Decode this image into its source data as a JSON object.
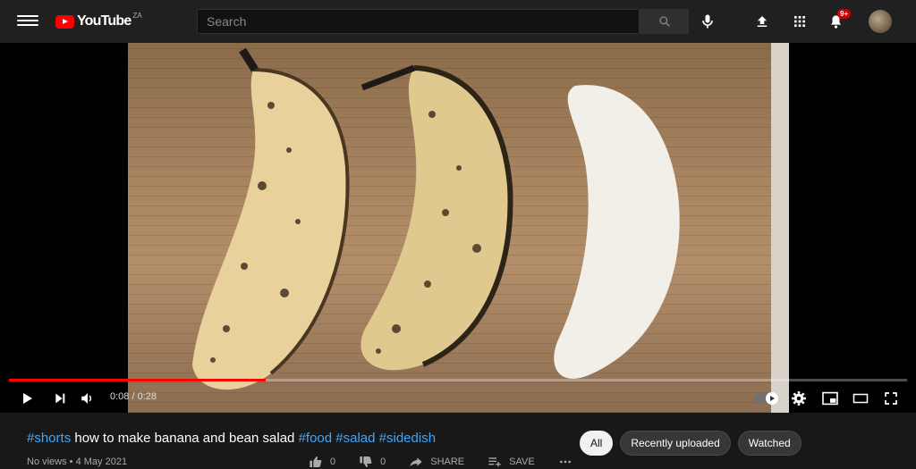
{
  "header": {
    "logo_text": "YouTube",
    "region": "ZA",
    "search_placeholder": "Search",
    "notification_count": "9+"
  },
  "player": {
    "current_time": "0:08",
    "duration": "0:28",
    "time_display": "0:08 / 0:28",
    "progress_fraction": 0.2857
  },
  "video": {
    "title_parts": [
      {
        "text": "#shorts",
        "hashtag": true
      },
      {
        "text": " how to make banana and bean salad ",
        "hashtag": false
      },
      {
        "text": "#food",
        "hashtag": true
      },
      {
        "text": " ",
        "hashtag": false
      },
      {
        "text": "#salad",
        "hashtag": true
      },
      {
        "text": " ",
        "hashtag": false
      },
      {
        "text": "#sidedish",
        "hashtag": true
      }
    ],
    "meta": "No views • 4 May 2021",
    "likes": "0",
    "dislikes": "0",
    "share_label": "SHARE",
    "save_label": "SAVE"
  },
  "chips": [
    {
      "label": "All",
      "active": true
    },
    {
      "label": "Recently uploaded",
      "active": false
    },
    {
      "label": "Watched",
      "active": false
    }
  ],
  "colors": {
    "accent": "#ff0000",
    "hashtag": "#3ea6ff",
    "background": "#181818",
    "topbar": "#202020"
  }
}
